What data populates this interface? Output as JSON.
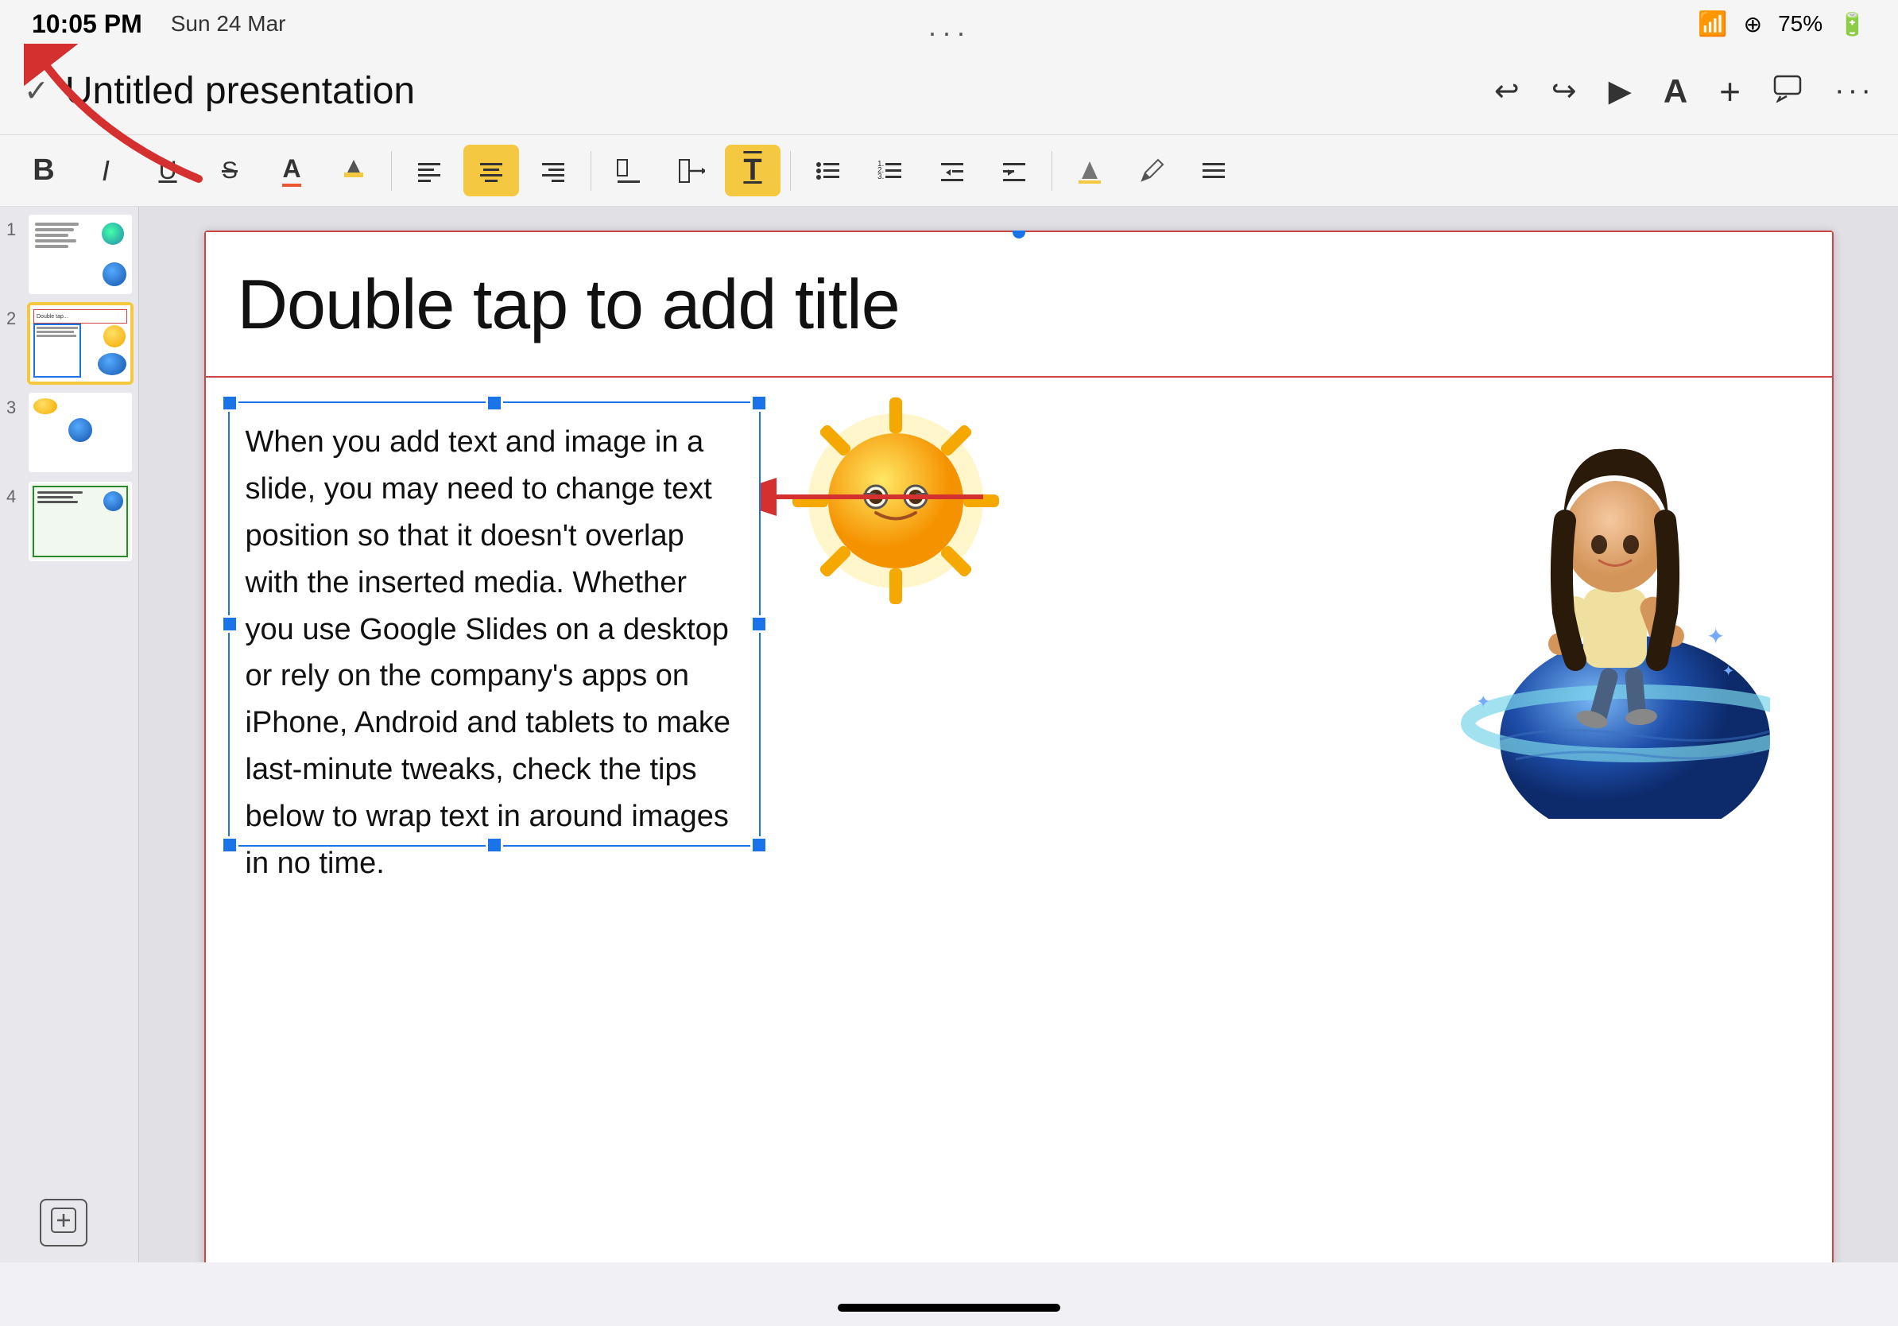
{
  "status_bar": {
    "time": "10:05 PM",
    "date": "Sun 24 Mar",
    "wifi_icon": "wifi",
    "battery": "75%"
  },
  "header": {
    "check_icon": "✓",
    "title": "Untitled presentation",
    "undo_icon": "↩",
    "redo_icon": "↪",
    "play_icon": "▶",
    "text_icon": "A",
    "add_icon": "+",
    "comment_icon": "💬",
    "more_icon": "•••"
  },
  "toolbar": {
    "bold": "B",
    "italic": "I",
    "underline": "U",
    "strikethrough": "S",
    "font_color": "A",
    "highlight": "🖊",
    "align_left": "≡",
    "align_center": "≡",
    "align_right": "≡",
    "align_bottom": "⊥",
    "align_middle": "↕",
    "text_fit": "T",
    "bullet_list": "≡",
    "num_list": "≡",
    "indent_less": "≡",
    "indent_more": "≡",
    "fill": "◆",
    "pencil": "✏",
    "menu": "≡"
  },
  "slides": [
    {
      "number": "1",
      "active": false
    },
    {
      "number": "2",
      "active": true
    },
    {
      "number": "3",
      "active": false
    },
    {
      "number": "4",
      "active": false
    }
  ],
  "slide": {
    "title_placeholder": "Double tap to add title",
    "text_content": "When you add text and image in a slide, you may need to change text position so that it doesn't overlap with the inserted media. Whether you use Google Slides on a desktop or rely on the company's apps on iPhone, Android and tablets to make last-minute tweaks, check the tips below to wrap text in around images in no time.",
    "has_selection": true
  },
  "annotations": {
    "arrow1_label": "points to title",
    "arrow2_label": "points to text box"
  },
  "bottom": {
    "add_slide_icon": "⊡",
    "home_bar": true
  }
}
